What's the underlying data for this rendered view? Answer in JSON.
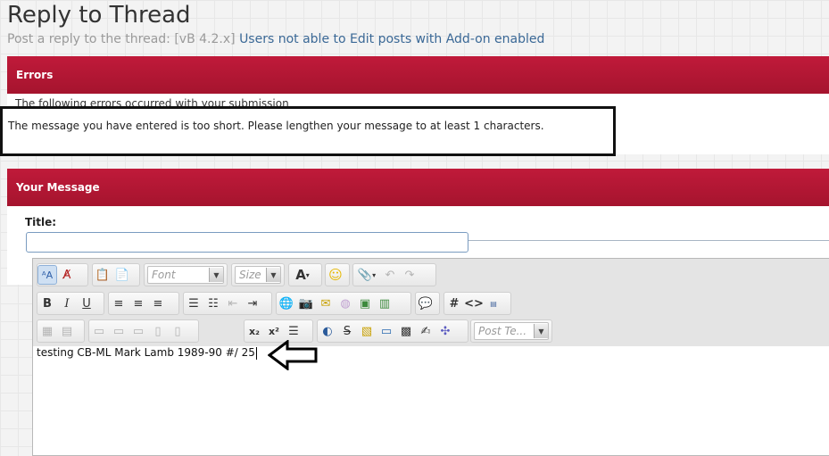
{
  "page": {
    "title": "Reply to Thread",
    "subtitle_prefix": "Post a reply to the thread: [vB 4.2.x]",
    "thread_link": "Users not able to Edit posts with Add-on enabled"
  },
  "errors": {
    "header": "Errors",
    "intro": "The following errors occurred with your submission",
    "message": "The message you have entered is too short. Please lengthen your message to at least 1 characters."
  },
  "message_block": {
    "header": "Your Message",
    "title_label": "Title:",
    "title_value": ""
  },
  "editor": {
    "font_placeholder": "Font",
    "size_placeholder": "Size",
    "post_template_placeholder": "Post Te...",
    "content": "testing CB-ML Mark Lamb 1989-90 #/ 25"
  },
  "annotation": {
    "arrow_color": "#000000"
  },
  "colors": {
    "header_red": "#b4173a",
    "link": "#3a6896"
  }
}
